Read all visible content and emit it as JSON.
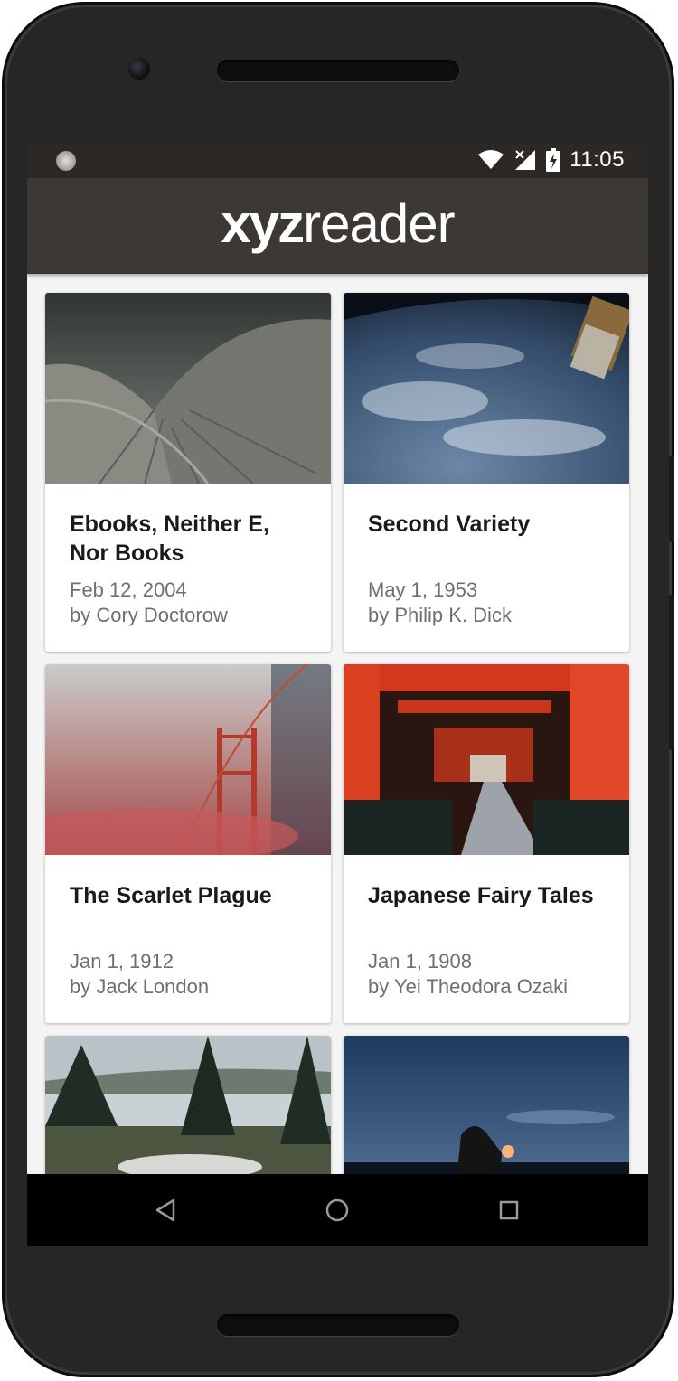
{
  "status_bar": {
    "time": "11:05",
    "icons": [
      "notification-dot-icon",
      "wifi-icon",
      "signal-icon",
      "battery-charging-icon"
    ]
  },
  "app_bar": {
    "logo_bold": "xyz",
    "logo_light": "reader"
  },
  "articles": [
    {
      "title": "Ebooks, Neither E, Nor Books",
      "date": "Feb 12, 2004",
      "author": "by Cory Doctorow"
    },
    {
      "title": "Second Variety",
      "date": "May 1, 1953",
      "author": "by Philip K. Dick"
    },
    {
      "title": "The Scarlet Plague",
      "date": "Jan 1, 1912",
      "author": "by Jack London"
    },
    {
      "title": "Japanese Fairy Tales",
      "date": "Jan 1, 1908",
      "author": "by Yei Theodora Ozaki"
    },
    {
      "title": "",
      "date": "",
      "author": ""
    },
    {
      "title": "",
      "date": "",
      "author": ""
    }
  ],
  "nav_bar": {
    "icons": [
      "back-icon",
      "home-icon",
      "recents-icon"
    ]
  },
  "colors": {
    "app_bar": "#3c3935",
    "status_bar": "#2b2825",
    "background": "#f4f4f4"
  }
}
